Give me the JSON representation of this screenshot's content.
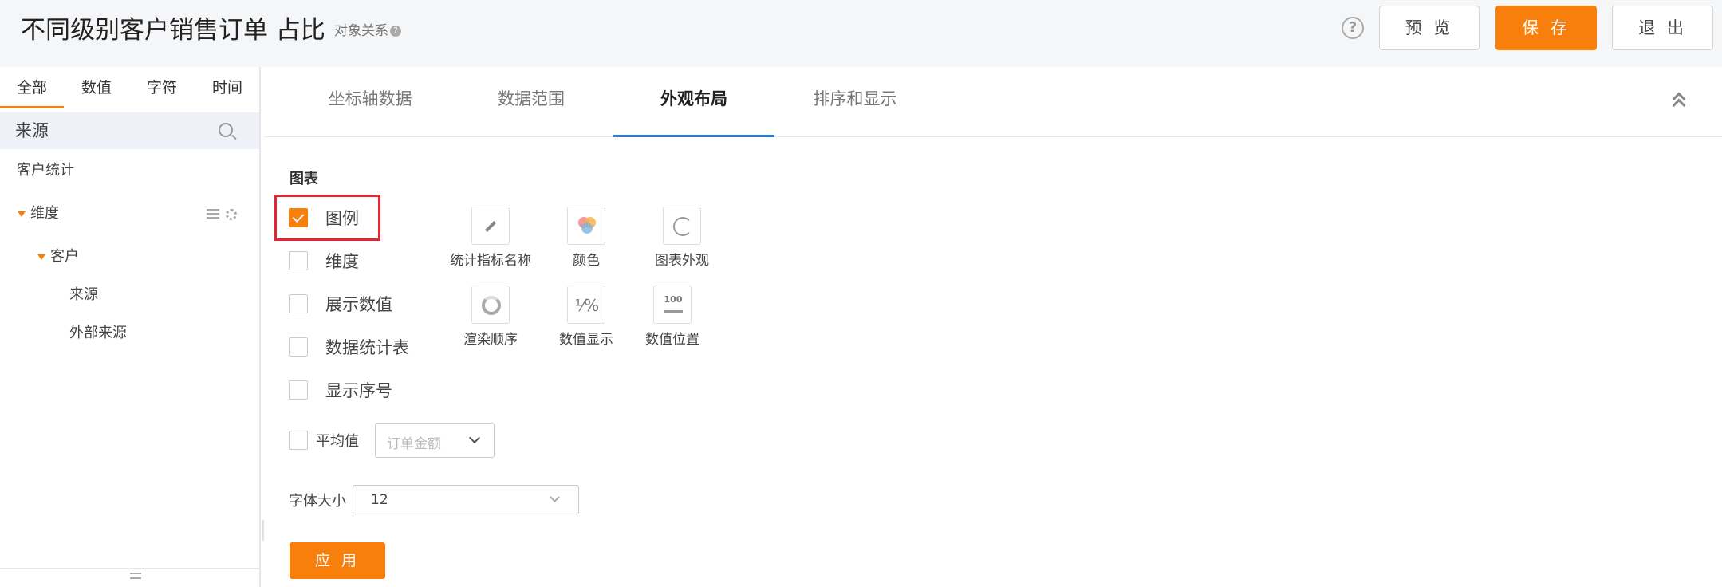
{
  "header": {
    "title": "不同级别客户销售订单 占比",
    "subtitle": "对象关系",
    "preview_label": "预 览",
    "save_label": "保 存",
    "exit_label": "退 出"
  },
  "sidebar": {
    "tabs": [
      "全部",
      "数值",
      "字符",
      "时间"
    ],
    "active_tab": "全部",
    "search_value": "来源",
    "tree": {
      "root": "客户统计",
      "dimension": "维度",
      "customer": "客户",
      "fields": [
        "来源",
        "外部来源"
      ]
    }
  },
  "main": {
    "tabs": [
      "坐标轴数据",
      "数据范围",
      "外观布局",
      "排序和显示"
    ],
    "active_tab": "外观布局",
    "section_title": "图表",
    "options": [
      {
        "label": "图例",
        "checked": true
      },
      {
        "label": "维度",
        "checked": false
      },
      {
        "label": "展示数值",
        "checked": false
      },
      {
        "label": "数据统计表",
        "checked": false
      },
      {
        "label": "显示序号",
        "checked": false
      }
    ],
    "tools": [
      {
        "label": "统计指标名称",
        "icon": "pencil-icon"
      },
      {
        "label": "颜色",
        "icon": "color-palette-icon"
      },
      {
        "label": "图表外观",
        "icon": "pie-chart-icon"
      },
      {
        "label": "渲染顺序",
        "icon": "ring-icon"
      },
      {
        "label": "数值显示",
        "icon": "fraction-icon",
        "glyph": "⅟%"
      },
      {
        "label": "数值位置",
        "icon": "number-position-icon",
        "glyph": "100"
      }
    ],
    "average": {
      "label": "平均值",
      "checked": false,
      "placeholder": "订单金额"
    },
    "font_size": {
      "label": "字体大小",
      "value": "12"
    },
    "apply_label": "应 用"
  },
  "colors": {
    "accent": "#f97f0c",
    "tab_underline": "#2a7cd3",
    "highlight": "#e0262f"
  }
}
